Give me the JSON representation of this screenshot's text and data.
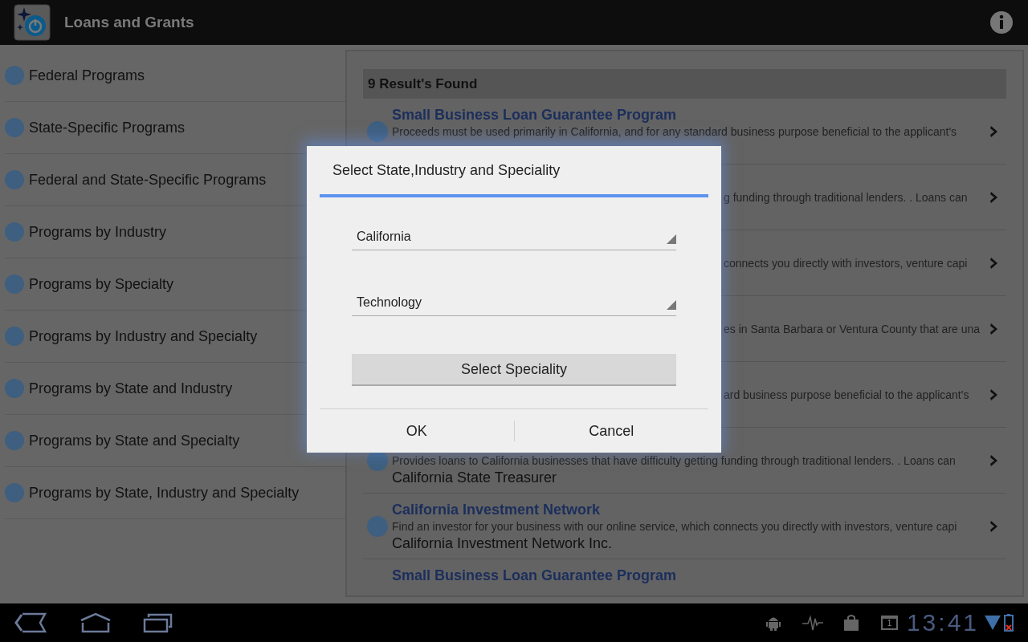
{
  "app_bar": {
    "title": "Loans and Grants"
  },
  "sidebar": {
    "items": [
      {
        "label": "Federal Programs"
      },
      {
        "label": "State-Specific Programs"
      },
      {
        "label": "Federal and State-Specific Programs"
      },
      {
        "label": "Programs by Industry"
      },
      {
        "label": "Programs by Specialty"
      },
      {
        "label": "Programs by Industry and Specialty"
      },
      {
        "label": "Programs by State and Industry"
      },
      {
        "label": "Programs by State and Specialty"
      },
      {
        "label": "Programs by State, Industry and Specialty"
      }
    ]
  },
  "results": {
    "header": "9 Result's Found",
    "rows": [
      {
        "kind": "full",
        "title": "Small Business Loan Guarantee Program",
        "description": "Proceeds must be used primarily in California, and for any standard business purpose beneficial to the applicant's"
      },
      {
        "kind": "covered",
        "description": "g funding through traditional lenders. . Loans can"
      },
      {
        "kind": "covered",
        "description": "connects you directly with investors, venture capi"
      },
      {
        "kind": "covered",
        "description": "es in Santa Barbara or Ventura County that are una"
      },
      {
        "kind": "covered",
        "description": "ard business purpose beneficial to the applicant's"
      },
      {
        "kind": "full",
        "description": "Provides loans to California businesses that have difficulty getting funding through traditional lenders. . Loans can",
        "subtitle": "California State Treasurer"
      },
      {
        "kind": "full",
        "title": "California Investment Network",
        "description": "Find an investor for your business with our online service, which connects you directly with investors, venture capi",
        "subtitle": "California Investment Network Inc."
      },
      {
        "kind": "full",
        "title": "Small Business Loan Guarantee Program"
      }
    ]
  },
  "dialog": {
    "title": "Select State,Industry and Speciality",
    "spinners": [
      {
        "value": "California"
      },
      {
        "value": "Technology"
      }
    ],
    "speciality_button": "Select Speciality",
    "buttons": [
      "OK",
      "Cancel"
    ]
  },
  "status_bar": {
    "calendar_day": "1",
    "time": "13:41"
  }
}
